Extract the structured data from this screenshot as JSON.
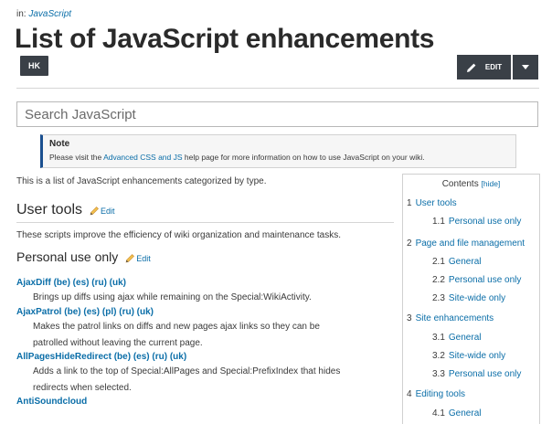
{
  "breadcrumb": {
    "prefix": "in:",
    "link": "JavaScript"
  },
  "page": {
    "title": "List of JavaScript enhancements"
  },
  "buttons": {
    "hk": "HK",
    "edit": "EDIT"
  },
  "search": {
    "placeholder": "Search JavaScript"
  },
  "note": {
    "title": "Note",
    "text_before": "Please visit the ",
    "link": "Advanced CSS and JS",
    "text_after": " help page for more information on how to use JavaScript on your wiki."
  },
  "intro": "This is a list of JavaScript enhancements categorized by type.",
  "section": {
    "heading": "User tools",
    "edit": "Edit",
    "description": "These scripts improve the efficiency of wiki organization and maintenance tasks.",
    "subheading": "Personal use only",
    "subedit": "Edit"
  },
  "entries": [
    {
      "name": "AjaxDiff",
      "langs": "(be) (es) (ru) (uk)",
      "desc1": "Brings up diffs using ajax while remaining on the Special:WikiActivity.",
      "desc2": ""
    },
    {
      "name": "AjaxPatrol",
      "langs": "(be) (es) (pl) (ru) (uk)",
      "desc1": "Makes the patrol links on diffs and new pages ajax links so they can be",
      "desc2": "patrolled without leaving the current page."
    },
    {
      "name": "AllPagesHideRedirect",
      "langs": "(be) (es) (ru) (uk)",
      "desc1": "Adds a link to the top of Special:AllPages and Special:PrefixIndex that hides",
      "desc2": "redirects when selected."
    },
    {
      "name": "AntiSoundcloud",
      "langs": "",
      "desc1": "",
      "desc2": ""
    }
  ],
  "toc": {
    "title": "Contents",
    "hide": "[hide]",
    "items": [
      {
        "num": "1",
        "label": "User tools"
      },
      {
        "num": "1.1",
        "label": "Personal use only"
      },
      {
        "num": "2",
        "label": "Page and file management"
      },
      {
        "num": "2.1",
        "label": "General"
      },
      {
        "num": "2.2",
        "label": "Personal use only"
      },
      {
        "num": "2.3",
        "label": "Site-wide only"
      },
      {
        "num": "3",
        "label": "Site enhancements"
      },
      {
        "num": "3.1",
        "label": "General"
      },
      {
        "num": "3.2",
        "label": "Site-wide only"
      },
      {
        "num": "3.3",
        "label": "Personal use only"
      },
      {
        "num": "4",
        "label": "Editing tools"
      },
      {
        "num": "4.1",
        "label": "General"
      }
    ]
  },
  "colors": {
    "link": "#0b6ea8",
    "button": "#3a4047",
    "note_accent": "#1a4f8f"
  },
  "icons": {
    "edit": "pencil-icon",
    "dropdown": "caret-down-icon"
  }
}
